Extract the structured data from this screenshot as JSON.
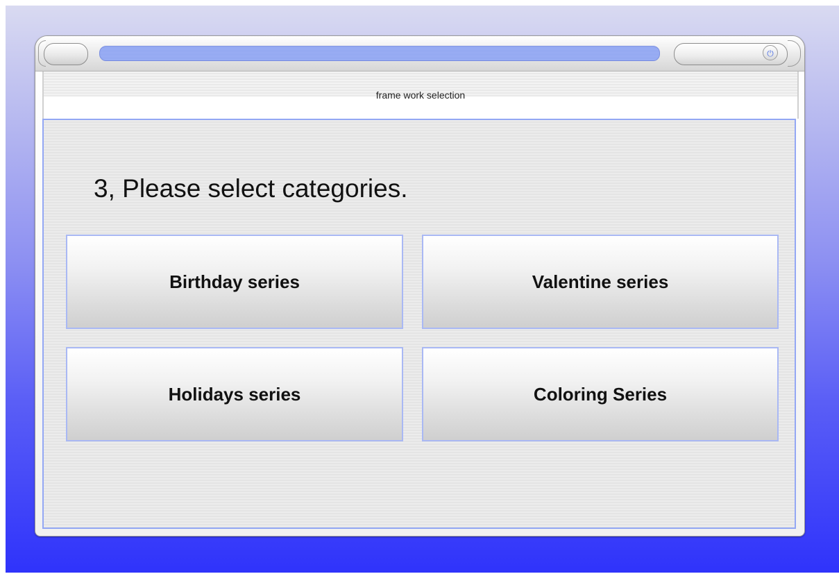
{
  "window": {
    "title": "frame work selection",
    "power_icon": "power-icon",
    "power_glyph": "⏻"
  },
  "main": {
    "prompt": "3, Please select categories.",
    "categories": [
      {
        "label": "Birthday series"
      },
      {
        "label": "Valentine series"
      },
      {
        "label": "Holidays series"
      },
      {
        "label": "Coloring Series"
      }
    ]
  },
  "colors": {
    "background_top": "#d9daf1",
    "background_bottom": "#2f33fb",
    "accent_border": "#93a7f4",
    "progress": "#9fb3f5"
  }
}
